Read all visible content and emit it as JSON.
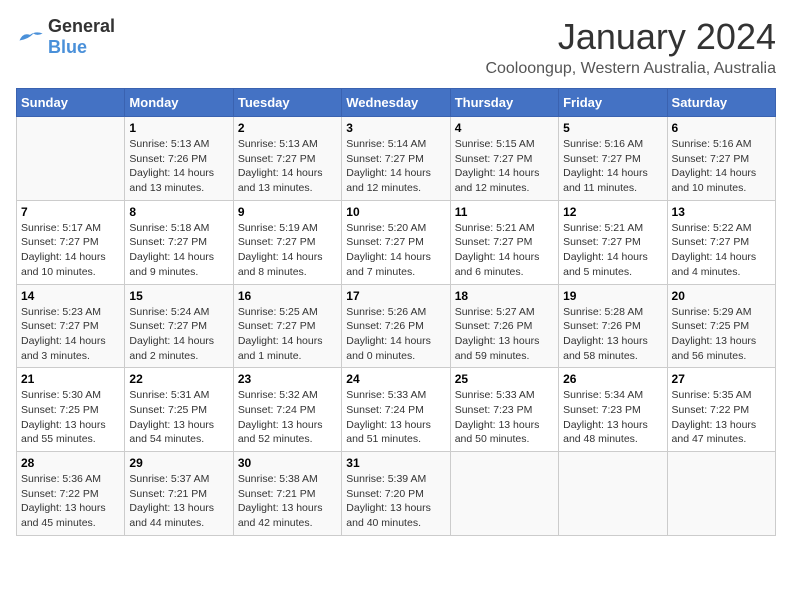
{
  "logo": {
    "general": "General",
    "blue": "Blue"
  },
  "title": "January 2024",
  "location": "Cooloongup, Western Australia, Australia",
  "headers": [
    "Sunday",
    "Monday",
    "Tuesday",
    "Wednesday",
    "Thursday",
    "Friday",
    "Saturday"
  ],
  "weeks": [
    [
      {
        "day": "",
        "info": ""
      },
      {
        "day": "1",
        "info": "Sunrise: 5:13 AM\nSunset: 7:26 PM\nDaylight: 14 hours\nand 13 minutes."
      },
      {
        "day": "2",
        "info": "Sunrise: 5:13 AM\nSunset: 7:27 PM\nDaylight: 14 hours\nand 13 minutes."
      },
      {
        "day": "3",
        "info": "Sunrise: 5:14 AM\nSunset: 7:27 PM\nDaylight: 14 hours\nand 12 minutes."
      },
      {
        "day": "4",
        "info": "Sunrise: 5:15 AM\nSunset: 7:27 PM\nDaylight: 14 hours\nand 12 minutes."
      },
      {
        "day": "5",
        "info": "Sunrise: 5:16 AM\nSunset: 7:27 PM\nDaylight: 14 hours\nand 11 minutes."
      },
      {
        "day": "6",
        "info": "Sunrise: 5:16 AM\nSunset: 7:27 PM\nDaylight: 14 hours\nand 10 minutes."
      }
    ],
    [
      {
        "day": "7",
        "info": "Sunrise: 5:17 AM\nSunset: 7:27 PM\nDaylight: 14 hours\nand 10 minutes."
      },
      {
        "day": "8",
        "info": "Sunrise: 5:18 AM\nSunset: 7:27 PM\nDaylight: 14 hours\nand 9 minutes."
      },
      {
        "day": "9",
        "info": "Sunrise: 5:19 AM\nSunset: 7:27 PM\nDaylight: 14 hours\nand 8 minutes."
      },
      {
        "day": "10",
        "info": "Sunrise: 5:20 AM\nSunset: 7:27 PM\nDaylight: 14 hours\nand 7 minutes."
      },
      {
        "day": "11",
        "info": "Sunrise: 5:21 AM\nSunset: 7:27 PM\nDaylight: 14 hours\nand 6 minutes."
      },
      {
        "day": "12",
        "info": "Sunrise: 5:21 AM\nSunset: 7:27 PM\nDaylight: 14 hours\nand 5 minutes."
      },
      {
        "day": "13",
        "info": "Sunrise: 5:22 AM\nSunset: 7:27 PM\nDaylight: 14 hours\nand 4 minutes."
      }
    ],
    [
      {
        "day": "14",
        "info": "Sunrise: 5:23 AM\nSunset: 7:27 PM\nDaylight: 14 hours\nand 3 minutes."
      },
      {
        "day": "15",
        "info": "Sunrise: 5:24 AM\nSunset: 7:27 PM\nDaylight: 14 hours\nand 2 minutes."
      },
      {
        "day": "16",
        "info": "Sunrise: 5:25 AM\nSunset: 7:27 PM\nDaylight: 14 hours\nand 1 minute."
      },
      {
        "day": "17",
        "info": "Sunrise: 5:26 AM\nSunset: 7:26 PM\nDaylight: 14 hours\nand 0 minutes."
      },
      {
        "day": "18",
        "info": "Sunrise: 5:27 AM\nSunset: 7:26 PM\nDaylight: 13 hours\nand 59 minutes."
      },
      {
        "day": "19",
        "info": "Sunrise: 5:28 AM\nSunset: 7:26 PM\nDaylight: 13 hours\nand 58 minutes."
      },
      {
        "day": "20",
        "info": "Sunrise: 5:29 AM\nSunset: 7:25 PM\nDaylight: 13 hours\nand 56 minutes."
      }
    ],
    [
      {
        "day": "21",
        "info": "Sunrise: 5:30 AM\nSunset: 7:25 PM\nDaylight: 13 hours\nand 55 minutes."
      },
      {
        "day": "22",
        "info": "Sunrise: 5:31 AM\nSunset: 7:25 PM\nDaylight: 13 hours\nand 54 minutes."
      },
      {
        "day": "23",
        "info": "Sunrise: 5:32 AM\nSunset: 7:24 PM\nDaylight: 13 hours\nand 52 minutes."
      },
      {
        "day": "24",
        "info": "Sunrise: 5:33 AM\nSunset: 7:24 PM\nDaylight: 13 hours\nand 51 minutes."
      },
      {
        "day": "25",
        "info": "Sunrise: 5:33 AM\nSunset: 7:23 PM\nDaylight: 13 hours\nand 50 minutes."
      },
      {
        "day": "26",
        "info": "Sunrise: 5:34 AM\nSunset: 7:23 PM\nDaylight: 13 hours\nand 48 minutes."
      },
      {
        "day": "27",
        "info": "Sunrise: 5:35 AM\nSunset: 7:22 PM\nDaylight: 13 hours\nand 47 minutes."
      }
    ],
    [
      {
        "day": "28",
        "info": "Sunrise: 5:36 AM\nSunset: 7:22 PM\nDaylight: 13 hours\nand 45 minutes."
      },
      {
        "day": "29",
        "info": "Sunrise: 5:37 AM\nSunset: 7:21 PM\nDaylight: 13 hours\nand 44 minutes."
      },
      {
        "day": "30",
        "info": "Sunrise: 5:38 AM\nSunset: 7:21 PM\nDaylight: 13 hours\nand 42 minutes."
      },
      {
        "day": "31",
        "info": "Sunrise: 5:39 AM\nSunset: 7:20 PM\nDaylight: 13 hours\nand 40 minutes."
      },
      {
        "day": "",
        "info": ""
      },
      {
        "day": "",
        "info": ""
      },
      {
        "day": "",
        "info": ""
      }
    ]
  ]
}
